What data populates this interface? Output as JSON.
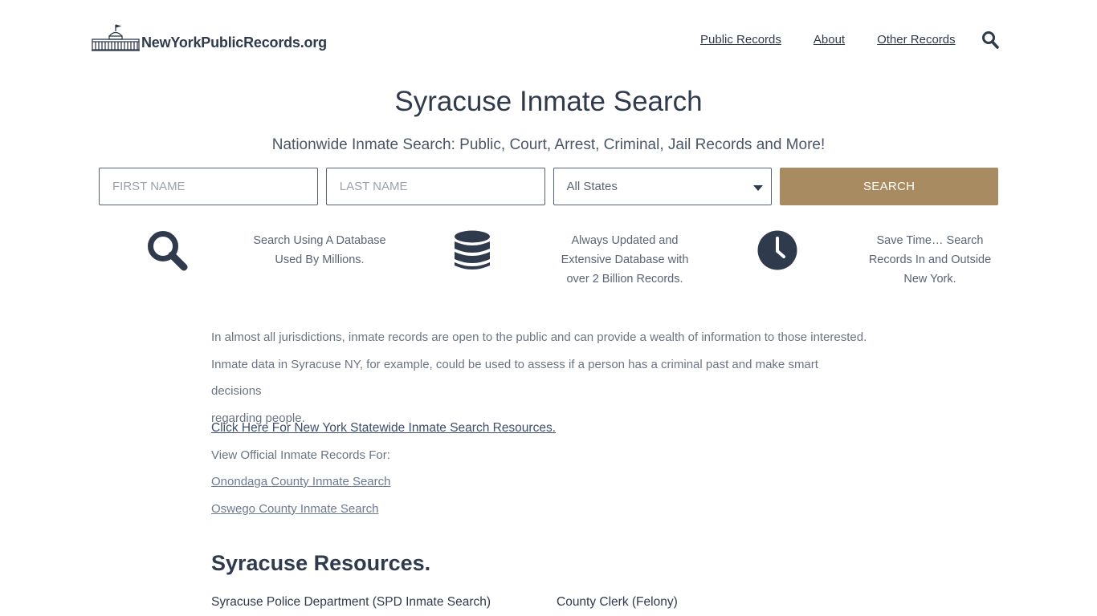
{
  "header": {
    "logo_text": "NewYorkPublicRecords.org",
    "nav": [
      {
        "label": "Public Records"
      },
      {
        "label": "About"
      },
      {
        "label": "Other Records"
      }
    ]
  },
  "hero": {
    "title": "Syracuse Inmate Search",
    "subtitle": "Nationwide Inmate Search: Public, Court, Arrest, Criminal, Jail Records and More!"
  },
  "search": {
    "first_name_placeholder": "FIRST NAME",
    "last_name_placeholder": "LAST NAME",
    "state_selected": "All States",
    "button_label": "SEARCH"
  },
  "features": [
    {
      "icon": "search-icon",
      "line1": "Search Using A Database",
      "line2": "Used By Millions.",
      "line3": ""
    },
    {
      "icon": "database-icon",
      "line1": "Always Updated and",
      "line2": "Extensive Database with",
      "line3": "over 2 Billion Records."
    },
    {
      "icon": "clock-icon",
      "line1": "Save Time… Search",
      "line2": "Records In and Outside",
      "line3": "New York."
    }
  ],
  "content": {
    "intro_line1": "In almost all jurisdictions, inmate records are open to the public and can provide a wealth of information to those interested.",
    "intro_line2": "Inmate data in Syracuse NY, for example, could be used to assess if a person has a criminal past and make smart decisions",
    "intro_line3": "regarding people.",
    "statewide_link": "Click Here For New York Statewide Inmate Search Resources.",
    "view_official": "View Official Inmate Records For:",
    "county_links": [
      "Onondaga County Inmate Search",
      "Oswego County Inmate Search"
    ],
    "resources_title": "Syracuse Resources.",
    "resources": [
      "Syracuse Police Department (SPD Inmate Search)",
      "County Clerk (Felony)"
    ]
  },
  "colors": {
    "text": "#2f3a4c",
    "accent": "#a88b60"
  }
}
